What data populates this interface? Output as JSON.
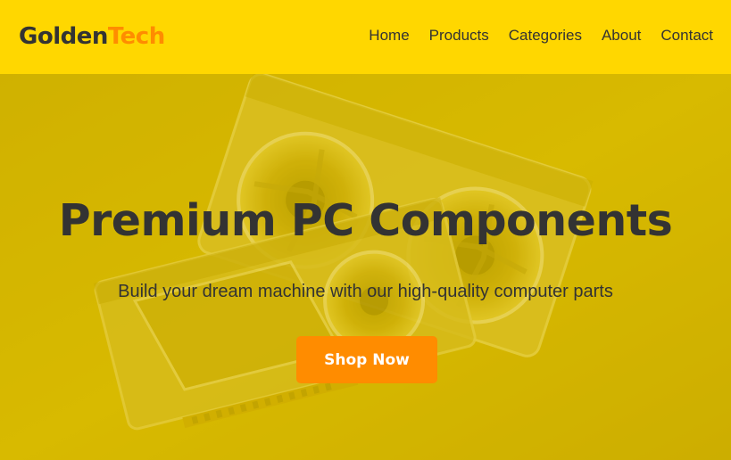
{
  "brand": {
    "name_part1": "Golden",
    "name_part2": "Tech"
  },
  "nav": {
    "items": [
      {
        "label": "Home"
      },
      {
        "label": "Products"
      },
      {
        "label": "Categories"
      },
      {
        "label": "About"
      },
      {
        "label": "Contact"
      }
    ]
  },
  "hero": {
    "title": "Premium PC Components",
    "subtitle": "Build your dream machine with our high-quality computer parts",
    "cta_label": "Shop Now",
    "background_image": "graphics-cards-photo"
  },
  "colors": {
    "nav_bg": "#ffd700",
    "accent": "#ff8c00",
    "text": "#333333",
    "hero_tint": "#d2b300"
  }
}
